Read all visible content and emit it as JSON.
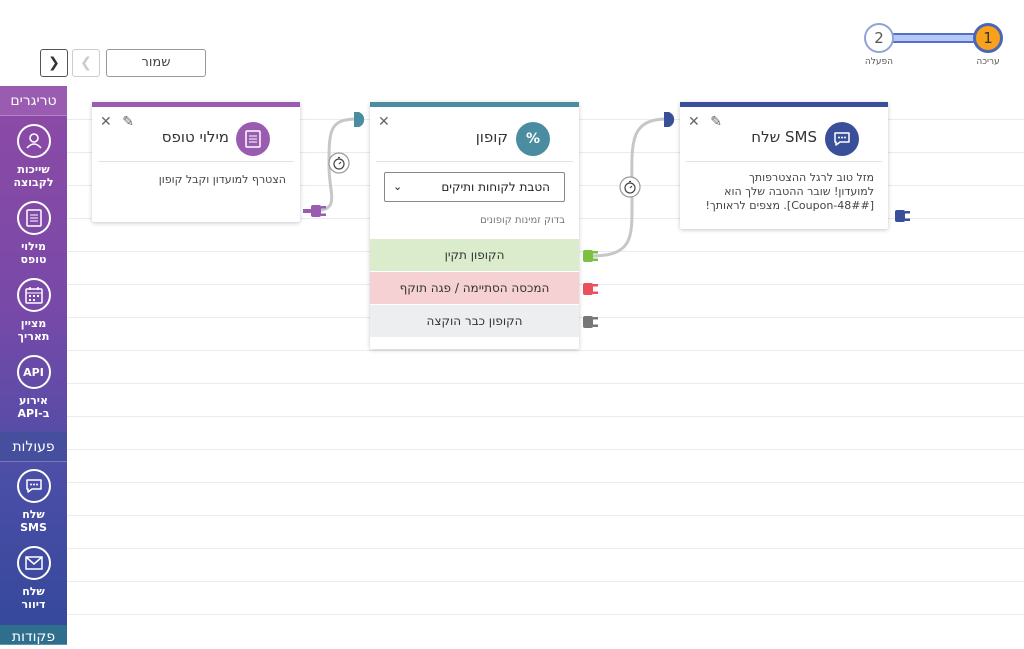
{
  "toolbar": {
    "next_icon": "chevron-right-icon",
    "prev_icon": "chevron-left-icon",
    "next_glyph": "❯",
    "prev_glyph": "❮",
    "save_label": "שמור"
  },
  "stepper": {
    "steps": [
      {
        "number": "1",
        "label": "עריכה",
        "active": true
      },
      {
        "number": "2",
        "label": "הפעלה",
        "active": false
      }
    ],
    "active_color": "#f7a21a"
  },
  "sidebar": {
    "sections": {
      "triggers": "טריגרים",
      "actions": "פעולות",
      "conditions": "פקודות"
    },
    "trigger_items": [
      {
        "label_line1": "שייכות",
        "label_line2": "לקבוצה",
        "icon": "group-membership-icon"
      },
      {
        "label_line1": "מילוי",
        "label_line2": "טופס",
        "icon": "form-icon"
      },
      {
        "label_line1": "מציין",
        "label_line2": "תאריך",
        "icon": "calendar-icon"
      },
      {
        "label_line1": "אירוע",
        "label_line2": "API-ב",
        "icon": "api-icon",
        "icon_text": "API"
      }
    ],
    "action_items": [
      {
        "label_line1": "שלח",
        "label_line2": "SMS",
        "icon": "sms-icon"
      },
      {
        "label_line1": "שלח",
        "label_line2": "דיוור",
        "icon": "mail-icon"
      }
    ]
  },
  "cards": {
    "form": {
      "title": "מילוי טופס",
      "icon": "form-icon",
      "body": "הצטרף למועדון וקבל קופון",
      "color": "#9a5cb0"
    },
    "coupon": {
      "title": "קופון",
      "icon": "percent-icon",
      "icon_text": "%",
      "select_value": "הטבת לקוחות ותיקים",
      "check_link": "בדוק זמינות קופונים",
      "color": "#4a8ca0",
      "outcomes": [
        {
          "label": "הקופון תקין",
          "color": "#7cc142"
        },
        {
          "label": "המכסה הסתיימה / פגה תוקף",
          "color": "#e9515d"
        },
        {
          "label": "הקופון כבר הוקצה",
          "color": "#777777"
        }
      ]
    },
    "sms": {
      "title": "שלח SMS",
      "icon": "sms-icon",
      "body_line1": "מזל טוב לרגל ההצטרפותך",
      "body_line2": "למועדון! שובר ההטבה שלך הוא",
      "body_line3": "[##Coupon-48]. מצפים לראותך!",
      "color": "#3a4f9a"
    }
  },
  "icons": {
    "close": "close-icon",
    "edit": "pencil-icon",
    "timer": "timer-icon",
    "plug": "plug-icon"
  }
}
